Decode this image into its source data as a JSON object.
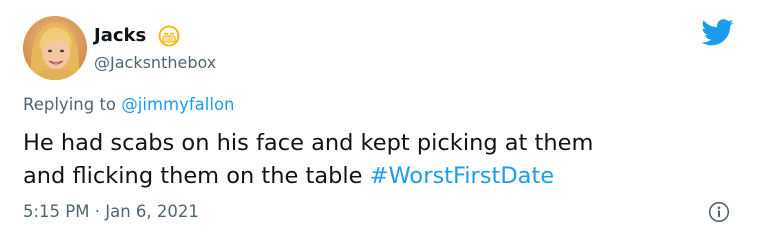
{
  "tweet": {
    "author": {
      "display_name": "Jacks",
      "display_emoji": "face-with-medical-mask",
      "handle": "@Jacksnthebox"
    },
    "reply_context": {
      "prefix": "Replying to ",
      "mention": "@jimmyfallon"
    },
    "body": {
      "line1": "He had scabs on his face and kept picking at them",
      "line2_text": "and flicking them on the table ",
      "hashtag": "#WorstFirstDate"
    },
    "timestamp": {
      "time": "5:15 PM",
      "separator": " · ",
      "date": "Jan 6, 2021"
    }
  },
  "icons": {
    "platform": "twitter-bird-icon",
    "info": "info-icon"
  },
  "colors": {
    "brand_blue": "#1d9bf0",
    "text_primary": "#0f1419",
    "text_secondary": "#536471",
    "background": "#ffffff"
  }
}
